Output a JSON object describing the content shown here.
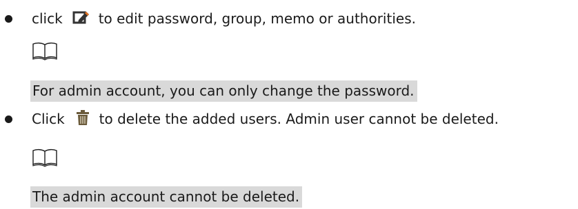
{
  "bullets": [
    {
      "before_icon": "click",
      "icon": "edit-icon",
      "after_icon": "to edit password, group, memo or authorities.",
      "note_icon": "book-note-icon",
      "note": "For admin account, you can only change the password."
    },
    {
      "before_icon": "Click",
      "icon": "delete-trash-icon",
      "after_icon": "to delete the added users. Admin user cannot be deleted.",
      "note_icon": "book-note-icon",
      "note": "The admin account cannot be deleted."
    }
  ],
  "colors": {
    "text": "#1a1a1a",
    "note_highlight": "#d9d9d9",
    "edit_icon_fill": "#333333",
    "edit_icon_accent": "#e07020",
    "trash_icon_fill": "#6a5a3a"
  }
}
